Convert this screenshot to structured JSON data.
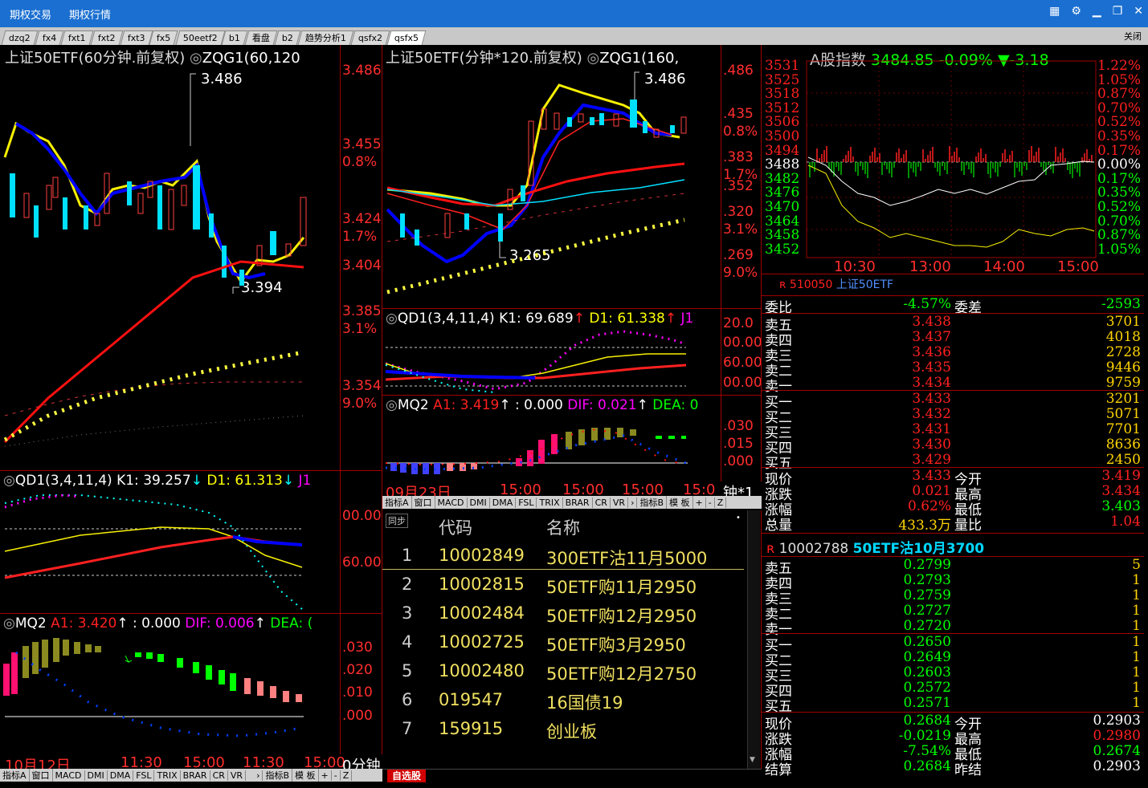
{
  "titlebar": {
    "menu1": "期权交易",
    "menu2": "期权行情"
  },
  "tabs": [
    "dzq2",
    "fx4",
    "fxt1",
    "fxt2",
    "fxt3",
    "fx5",
    "50eetf2",
    "b1",
    "看盘",
    "b2",
    "趋势分析1",
    "qsfx2",
    "qsfx5"
  ],
  "tabs_close": "关闭",
  "left_chart": {
    "title_white": "上证50ETF",
    "title_rest": "(60分钟.前复权)",
    "indicator": "ZQG1(60,120",
    "peak_label": "3.486",
    "low_label": "3.394",
    "axis": [
      "3.486",
      "3.455",
      "0.8%",
      "3.424",
      "1.7%",
      "3.404",
      "3.385",
      "3.1%",
      "3.354",
      "9.0%"
    ]
  },
  "left_qd1": {
    "name": "QD1(3,4,11,4)",
    "k": "K1: 39.257",
    "d": "D1: 61.313",
    "j": "J1",
    "axis": [
      "00.00",
      "60.00"
    ]
  },
  "left_mq2": {
    "name": "MQ2",
    "a1": "A1: 3.420",
    "z": ": 0.000",
    "dif": "DIF: 0.006",
    "dea": "DEA: (",
    "axis": [
      ".030",
      ".020",
      ".010",
      ".000"
    ]
  },
  "left_time": [
    "10月12日",
    "11:30",
    "15:00",
    "11:30",
    "15:00",
    "0分钟"
  ],
  "mid_chart": {
    "title_white": "上证50ETF",
    "title_rest": "(分钟*120.前复权)",
    "indicator": "ZQG1(160,",
    "peak_label": "3.486",
    "low_label": "3.265",
    "axis": [
      ".486",
      ".435",
      "0.8%",
      ".383",
      "1.7%",
      ".352",
      ".320",
      "3.1%",
      ".269",
      "9.0%"
    ]
  },
  "mid_qd1": {
    "name": "QD1(3,4,11,4)",
    "k": "K1: 69.689",
    "d": "D1: 61.338",
    "j": "J1",
    "axis": [
      "20.0",
      "00.00",
      "60.00",
      "00.00"
    ]
  },
  "mid_mq2": {
    "name": "MQ2",
    "a1": "A1: 3.419",
    "z": ": 0.000",
    "dif": "DIF: 0.021",
    "dea": "DEA: 0",
    "axis": [
      ".030",
      ".015",
      ".000"
    ]
  },
  "mid_time": [
    "09月23日",
    "15:00",
    "15:00",
    "15:00",
    "15:0",
    "钟*1"
  ],
  "bottom_tabs": [
    "指标A",
    "窗口",
    "MACD",
    "DMI",
    "DMA",
    "FSL",
    "TRIX",
    "BRAR",
    "CR",
    "VR",
    "指标B",
    "模 板",
    "+",
    "-",
    "Z"
  ],
  "watchlist": {
    "sync": "同步",
    "col_code": "代码",
    "col_name": "名称",
    "rows": [
      {
        "idx": "1",
        "code": "10002849",
        "name": "300ETF沽11月5000"
      },
      {
        "idx": "2",
        "code": "10002815",
        "name": "50ETF购11月2950"
      },
      {
        "idx": "3",
        "code": "10002484",
        "name": "50ETF购12月2950"
      },
      {
        "idx": "4",
        "code": "10002725",
        "name": "50ETF购3月2950"
      },
      {
        "idx": "5",
        "code": "10002480",
        "name": "50ETF购12月2750"
      },
      {
        "idx": "6",
        "code": "019547",
        "name": "16国债19"
      },
      {
        "idx": "7",
        "code": "159915",
        "name": "创业板"
      }
    ],
    "tab": "自选股"
  },
  "index_panel": {
    "title": "A股指数",
    "value": "3484.85",
    "pct": "-0.09%",
    "change": "▼-3.18",
    "left_axis": [
      "3531",
      "3525",
      "3518",
      "3512",
      "3506",
      "3500",
      "3494",
      "3488",
      "3482",
      "3476",
      "3470",
      "3464",
      "3458",
      "3452"
    ],
    "right_axis": [
      "1.22%",
      "1.05%",
      "0.87%",
      "0.70%",
      "0.52%",
      "0.35%",
      "0.17%",
      "0.00%",
      "0.17%",
      "0.35%",
      "0.52%",
      "0.70%",
      "0.87%",
      "1.05%"
    ],
    "times": [
      "10:30",
      "13:00",
      "14:00",
      "15:00"
    ]
  },
  "quote": {
    "code": "510050",
    "name": "上证50ETF",
    "weibi_label": "委比",
    "weibi": "-4.57%",
    "weicha_label": "委差",
    "weicha": "-2593",
    "asks": [
      {
        "label": "卖五",
        "price": "3.438",
        "vol": "3701"
      },
      {
        "label": "卖四",
        "price": "3.437",
        "vol": "4018"
      },
      {
        "label": "卖三",
        "price": "3.436",
        "vol": "2728"
      },
      {
        "label": "卖二",
        "price": "3.435",
        "vol": "9446"
      },
      {
        "label": "卖一",
        "price": "3.434",
        "vol": "9759"
      }
    ],
    "bids": [
      {
        "label": "买一",
        "price": "3.433",
        "vol": "3201"
      },
      {
        "label": "买二",
        "price": "3.432",
        "vol": "5071"
      },
      {
        "label": "买三",
        "price": "3.431",
        "vol": "7701"
      },
      {
        "label": "买四",
        "price": "3.430",
        "vol": "8636"
      },
      {
        "label": "买五",
        "price": "3.429",
        "vol": "2450"
      }
    ],
    "stats": [
      {
        "l1": "现价",
        "v1": "3.433",
        "l2": "今开",
        "v2": "3.419"
      },
      {
        "l1": "涨跌",
        "v1": "0.021",
        "l2": "最高",
        "v2": "3.434"
      },
      {
        "l1": "涨幅",
        "v1": "0.62%",
        "l2": "最低",
        "v2": "3.403"
      },
      {
        "l1": "总量",
        "v1": "433.3万",
        "l2": "量比",
        "v2": "1.04"
      }
    ]
  },
  "option_quote": {
    "code": "10002788",
    "name": "50ETF沽10月3700",
    "asks": [
      {
        "label": "卖五",
        "price": "0.2799",
        "vol": "5"
      },
      {
        "label": "卖四",
        "price": "0.2793",
        "vol": "1"
      },
      {
        "label": "卖三",
        "price": "0.2759",
        "vol": "1"
      },
      {
        "label": "卖二",
        "price": "0.2727",
        "vol": "1"
      },
      {
        "label": "卖一",
        "price": "0.2720",
        "vol": "1"
      }
    ],
    "bids": [
      {
        "label": "买一",
        "price": "0.2650",
        "vol": "1"
      },
      {
        "label": "买二",
        "price": "0.2649",
        "vol": "1"
      },
      {
        "label": "买三",
        "price": "0.2603",
        "vol": "1"
      },
      {
        "label": "买四",
        "price": "0.2572",
        "vol": "1"
      },
      {
        "label": "买五",
        "price": "0.2571",
        "vol": "1"
      }
    ],
    "stats": [
      {
        "l1": "现价",
        "v1": "0.2684",
        "l2": "今开",
        "v2": "0.2903"
      },
      {
        "l1": "涨跌",
        "v1": "-0.0219",
        "l2": "最高",
        "v2": "0.2980"
      },
      {
        "l1": "涨幅",
        "v1": "-7.54%",
        "l2": "最低",
        "v2": "0.2674"
      },
      {
        "l1": "结算",
        "v1": "0.2684",
        "l2": "昨结",
        "v2": "0.2903"
      }
    ]
  }
}
